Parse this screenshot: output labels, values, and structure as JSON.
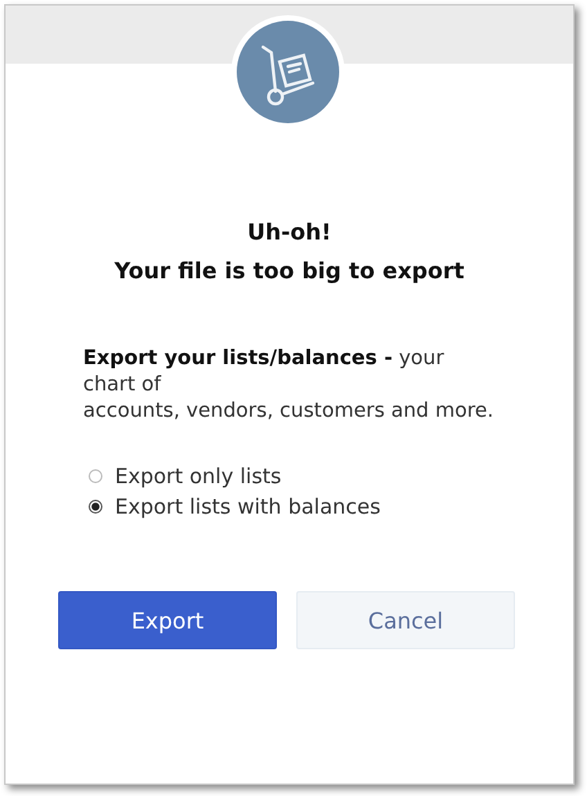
{
  "dialog": {
    "title_lines": [
      "Uh-oh!",
      "Your file is too big to export"
    ],
    "description": "**Export your lists/balances -** your\nchart of\naccounts, vendors, customers and more.",
    "options": [
      {
        "label": "Export only lists",
        "selected": false
      },
      {
        "label": "Export lists with balances",
        "selected": true
      }
    ],
    "buttons": [
      {
        "label": "Export",
        "kind": "primary"
      },
      {
        "label": "Cancel",
        "kind": "secondary"
      }
    ]
  }
}
